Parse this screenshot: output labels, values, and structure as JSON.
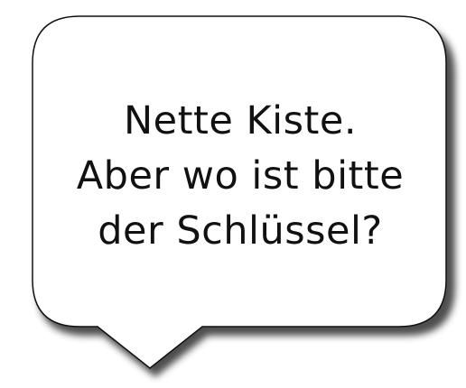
{
  "speech_bubble": {
    "lines": [
      "Nette Kiste.",
      "Aber wo ist bitte",
      "der Schlüssel?"
    ],
    "fill_color": "#ffffff",
    "stroke_color": "#111111",
    "shadow_color": "#3a3a3a"
  }
}
